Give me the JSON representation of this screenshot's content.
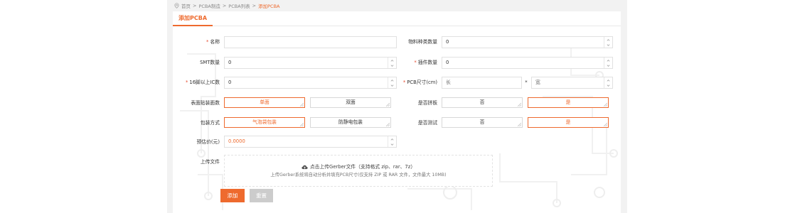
{
  "breadcrumb": {
    "items": [
      "首页",
      "PCBA制造",
      "PCBA列表"
    ],
    "separator": ">",
    "current": "添加PCBA"
  },
  "tab": {
    "label": "添加PCBA"
  },
  "form": {
    "name": {
      "label": "名称",
      "value": ""
    },
    "material_types": {
      "label": "物料种类数量",
      "value": "0"
    },
    "smt_count": {
      "label": "SMT数量",
      "value": "0"
    },
    "plugin_count": {
      "label": "插件数量",
      "value": "0"
    },
    "ic_16pin": {
      "label": "16脚以上IC数",
      "value": "0"
    },
    "pcb_size": {
      "label": "PCB尺寸(cm)",
      "length_placeholder": "长",
      "separator": "*",
      "width_placeholder": "宽"
    },
    "mount_sides": {
      "label": "表面贴装面数",
      "options": [
        "单面",
        "双面"
      ],
      "selected": "单面"
    },
    "panel": {
      "label": "是否拼板",
      "options": [
        "否",
        "是"
      ],
      "selected": "是"
    },
    "packaging": {
      "label": "包装方式",
      "options": [
        "气泡袋包装",
        "防静电包装"
      ],
      "selected": "气泡袋包装"
    },
    "testing": {
      "label": "是否测试",
      "options": [
        "否",
        "是"
      ],
      "selected": "是"
    },
    "estimate": {
      "label": "预估价(元)",
      "value": "0.0000"
    },
    "upload": {
      "label": "上传文件",
      "prompt": "点击上传Gerber文件（支持格式 zip、rar、7z）",
      "hint": "上传Gerber系统将自动分析并填充PCB尺寸(仅支持 ZIP 或 RAR 文件，文件最大 10MB)"
    }
  },
  "buttons": {
    "add": "添加",
    "reset": "重置"
  },
  "colors": {
    "accent": "#ee6a2e",
    "required": "#e64a2e",
    "reset_bg": "#cccccc"
  }
}
